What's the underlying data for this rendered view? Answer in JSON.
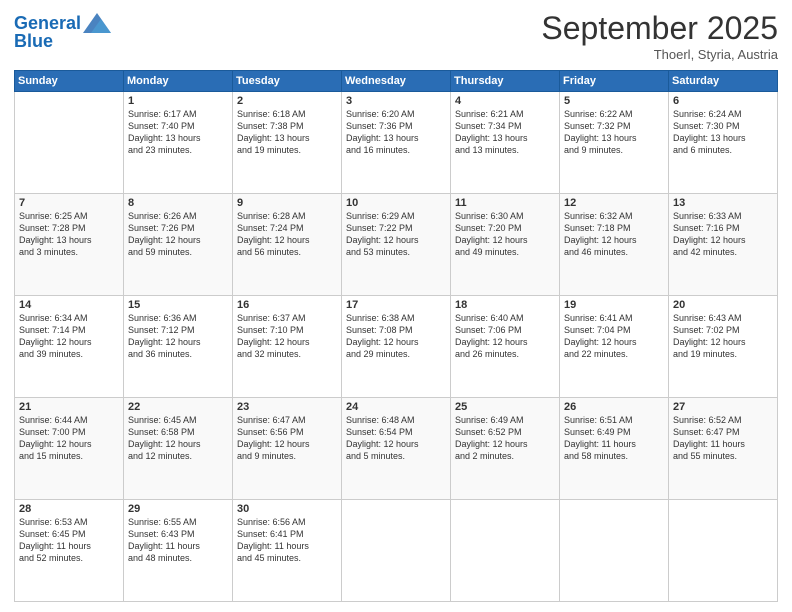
{
  "header": {
    "logo_line1": "General",
    "logo_line2": "Blue",
    "month": "September 2025",
    "location": "Thoerl, Styria, Austria"
  },
  "days_of_week": [
    "Sunday",
    "Monday",
    "Tuesday",
    "Wednesday",
    "Thursday",
    "Friday",
    "Saturday"
  ],
  "weeks": [
    [
      {
        "day": "",
        "info": ""
      },
      {
        "day": "1",
        "info": "Sunrise: 6:17 AM\nSunset: 7:40 PM\nDaylight: 13 hours\nand 23 minutes."
      },
      {
        "day": "2",
        "info": "Sunrise: 6:18 AM\nSunset: 7:38 PM\nDaylight: 13 hours\nand 19 minutes."
      },
      {
        "day": "3",
        "info": "Sunrise: 6:20 AM\nSunset: 7:36 PM\nDaylight: 13 hours\nand 16 minutes."
      },
      {
        "day": "4",
        "info": "Sunrise: 6:21 AM\nSunset: 7:34 PM\nDaylight: 13 hours\nand 13 minutes."
      },
      {
        "day": "5",
        "info": "Sunrise: 6:22 AM\nSunset: 7:32 PM\nDaylight: 13 hours\nand 9 minutes."
      },
      {
        "day": "6",
        "info": "Sunrise: 6:24 AM\nSunset: 7:30 PM\nDaylight: 13 hours\nand 6 minutes."
      }
    ],
    [
      {
        "day": "7",
        "info": "Sunrise: 6:25 AM\nSunset: 7:28 PM\nDaylight: 13 hours\nand 3 minutes."
      },
      {
        "day": "8",
        "info": "Sunrise: 6:26 AM\nSunset: 7:26 PM\nDaylight: 12 hours\nand 59 minutes."
      },
      {
        "day": "9",
        "info": "Sunrise: 6:28 AM\nSunset: 7:24 PM\nDaylight: 12 hours\nand 56 minutes."
      },
      {
        "day": "10",
        "info": "Sunrise: 6:29 AM\nSunset: 7:22 PM\nDaylight: 12 hours\nand 53 minutes."
      },
      {
        "day": "11",
        "info": "Sunrise: 6:30 AM\nSunset: 7:20 PM\nDaylight: 12 hours\nand 49 minutes."
      },
      {
        "day": "12",
        "info": "Sunrise: 6:32 AM\nSunset: 7:18 PM\nDaylight: 12 hours\nand 46 minutes."
      },
      {
        "day": "13",
        "info": "Sunrise: 6:33 AM\nSunset: 7:16 PM\nDaylight: 12 hours\nand 42 minutes."
      }
    ],
    [
      {
        "day": "14",
        "info": "Sunrise: 6:34 AM\nSunset: 7:14 PM\nDaylight: 12 hours\nand 39 minutes."
      },
      {
        "day": "15",
        "info": "Sunrise: 6:36 AM\nSunset: 7:12 PM\nDaylight: 12 hours\nand 36 minutes."
      },
      {
        "day": "16",
        "info": "Sunrise: 6:37 AM\nSunset: 7:10 PM\nDaylight: 12 hours\nand 32 minutes."
      },
      {
        "day": "17",
        "info": "Sunrise: 6:38 AM\nSunset: 7:08 PM\nDaylight: 12 hours\nand 29 minutes."
      },
      {
        "day": "18",
        "info": "Sunrise: 6:40 AM\nSunset: 7:06 PM\nDaylight: 12 hours\nand 26 minutes."
      },
      {
        "day": "19",
        "info": "Sunrise: 6:41 AM\nSunset: 7:04 PM\nDaylight: 12 hours\nand 22 minutes."
      },
      {
        "day": "20",
        "info": "Sunrise: 6:43 AM\nSunset: 7:02 PM\nDaylight: 12 hours\nand 19 minutes."
      }
    ],
    [
      {
        "day": "21",
        "info": "Sunrise: 6:44 AM\nSunset: 7:00 PM\nDaylight: 12 hours\nand 15 minutes."
      },
      {
        "day": "22",
        "info": "Sunrise: 6:45 AM\nSunset: 6:58 PM\nDaylight: 12 hours\nand 12 minutes."
      },
      {
        "day": "23",
        "info": "Sunrise: 6:47 AM\nSunset: 6:56 PM\nDaylight: 12 hours\nand 9 minutes."
      },
      {
        "day": "24",
        "info": "Sunrise: 6:48 AM\nSunset: 6:54 PM\nDaylight: 12 hours\nand 5 minutes."
      },
      {
        "day": "25",
        "info": "Sunrise: 6:49 AM\nSunset: 6:52 PM\nDaylight: 12 hours\nand 2 minutes."
      },
      {
        "day": "26",
        "info": "Sunrise: 6:51 AM\nSunset: 6:49 PM\nDaylight: 11 hours\nand 58 minutes."
      },
      {
        "day": "27",
        "info": "Sunrise: 6:52 AM\nSunset: 6:47 PM\nDaylight: 11 hours\nand 55 minutes."
      }
    ],
    [
      {
        "day": "28",
        "info": "Sunrise: 6:53 AM\nSunset: 6:45 PM\nDaylight: 11 hours\nand 52 minutes."
      },
      {
        "day": "29",
        "info": "Sunrise: 6:55 AM\nSunset: 6:43 PM\nDaylight: 11 hours\nand 48 minutes."
      },
      {
        "day": "30",
        "info": "Sunrise: 6:56 AM\nSunset: 6:41 PM\nDaylight: 11 hours\nand 45 minutes."
      },
      {
        "day": "",
        "info": ""
      },
      {
        "day": "",
        "info": ""
      },
      {
        "day": "",
        "info": ""
      },
      {
        "day": "",
        "info": ""
      }
    ]
  ]
}
